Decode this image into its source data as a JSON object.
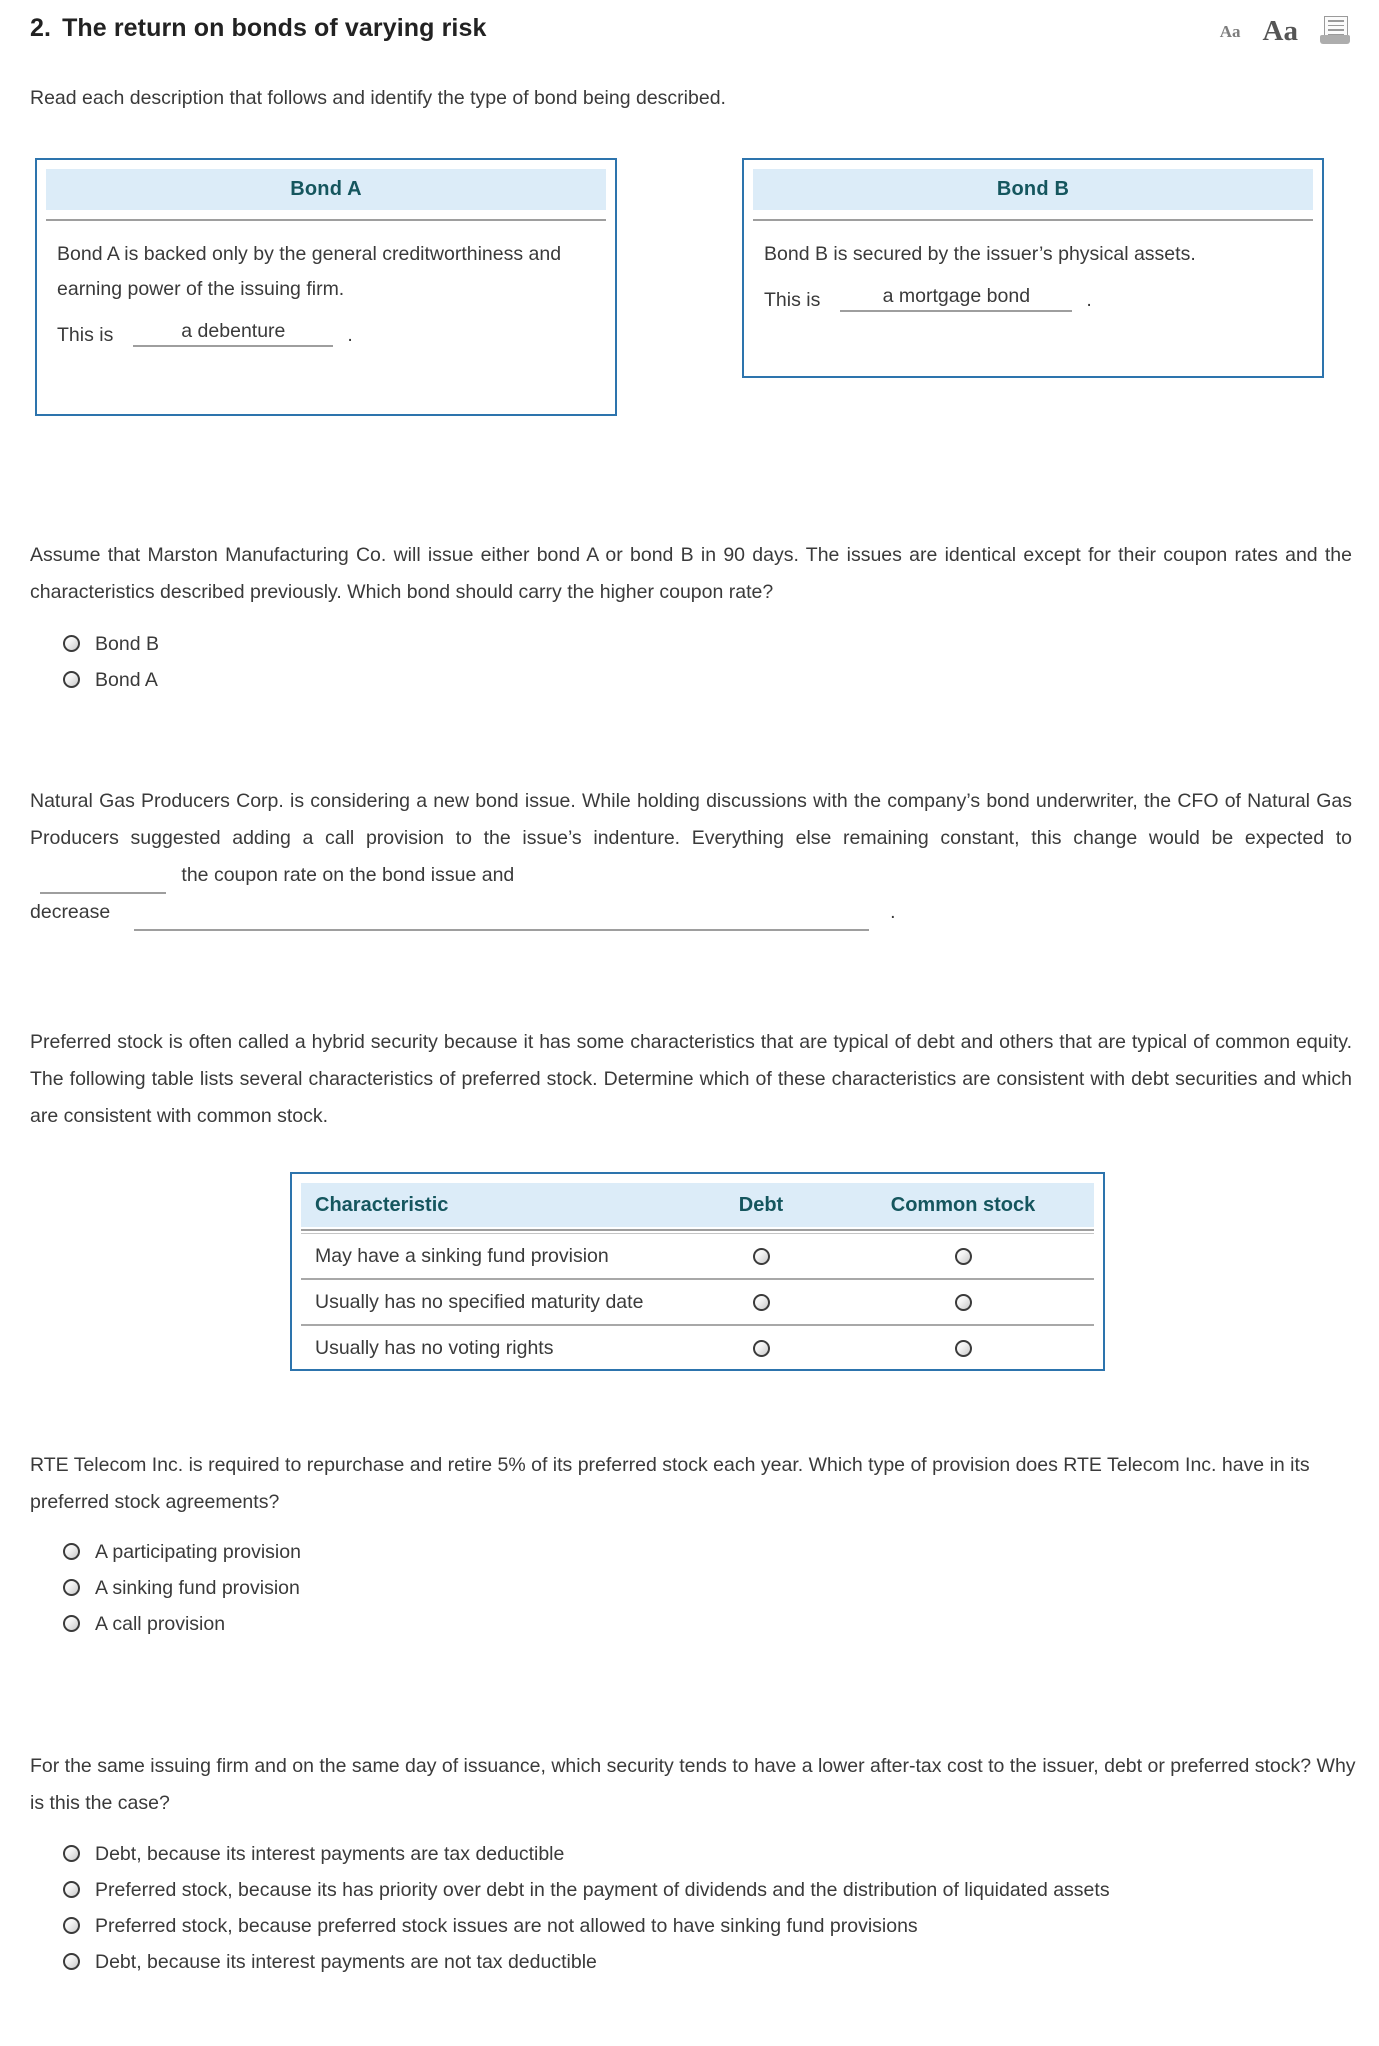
{
  "header": {
    "question_number": "2.",
    "title": "The return on bonds of varying risk",
    "tools": {
      "font_small_label": "Aa",
      "font_large_label": "Aa",
      "print_icon": "printer-icon"
    }
  },
  "intro": "Read each description that follows and identify the type of bond being described.",
  "bonds": [
    {
      "title": "Bond A",
      "description": "Bond A is backed only by the general creditworthiness and earning power of the issuing firm.",
      "answer_prefix": "This is",
      "answer_value": "a debenture",
      "answer_suffix": "."
    },
    {
      "title": "Bond B",
      "description": "Bond B is secured by the issuer’s physical assets.",
      "answer_prefix": "This is",
      "answer_value": "a mortgage bond",
      "answer_suffix": "."
    }
  ],
  "marston": {
    "prompt": "Assume that Marston Manufacturing Co. will issue either bond A or bond B in 90 days. The issues are identical except for their coupon rates and the characteristics described previously. Which bond should carry the higher coupon rate?",
    "options": [
      "Bond B",
      "Bond A"
    ]
  },
  "natural_gas": {
    "text_part1": "Natural Gas Producers Corp. is considering a new bond issue. While holding discussions with the company’s bond underwriter, the CFO of Natural Gas Producers suggested adding a call provision to the issue’s indenture. Everything else remaining constant, this change would be expected to",
    "blank1_value": "",
    "text_part2": "the coupon rate on the bond issue and",
    "text_part3": "decrease",
    "blank2_value": "",
    "text_part4": "."
  },
  "preferred_intro": "Preferred stock is often called a hybrid security because it has some characteristics that are typical of debt and others that are typical of common equity. The following table lists several characteristics of preferred stock. Determine which of these characteristics are consistent with debt securities and which are consistent with common stock.",
  "char_table": {
    "columns": [
      "Characteristic",
      "Debt",
      "Common stock"
    ],
    "rows": [
      {
        "characteristic": "May have a sinking fund provision",
        "debt_selected": false,
        "common_selected": false
      },
      {
        "characteristic": "Usually has no specified maturity date",
        "debt_selected": false,
        "common_selected": false
      },
      {
        "characteristic": "Usually has no voting rights",
        "debt_selected": false,
        "common_selected": false
      }
    ]
  },
  "rte": {
    "prompt": "RTE Telecom Inc. is required to repurchase and retire 5% of its preferred stock each year. Which type of provision does RTE Telecom Inc. have in its preferred stock agreements?",
    "options": [
      "A participating provision",
      "A sinking fund provision",
      "A call provision"
    ]
  },
  "aftertax": {
    "prompt": "For the same issuing firm and on the same day of issuance, which security tends to have a lower after-tax cost to the issuer, debt or preferred stock? Why is this the case?",
    "options": [
      "Debt, because its interest payments are tax deductible",
      "Preferred stock, because its has priority over debt in the payment of dividends and the distribution of liquidated assets",
      "Preferred stock, because preferred stock issues are not allowed to have sinking fund provisions",
      "Debt, because its interest payments are not tax deductible"
    ]
  },
  "colors": {
    "box_border": "#2d74ad",
    "header_band": "#dcecf8",
    "heading_teal": "#15565e",
    "rule_gray": "#9e9e9e",
    "body_text": "#3a3a3a"
  }
}
